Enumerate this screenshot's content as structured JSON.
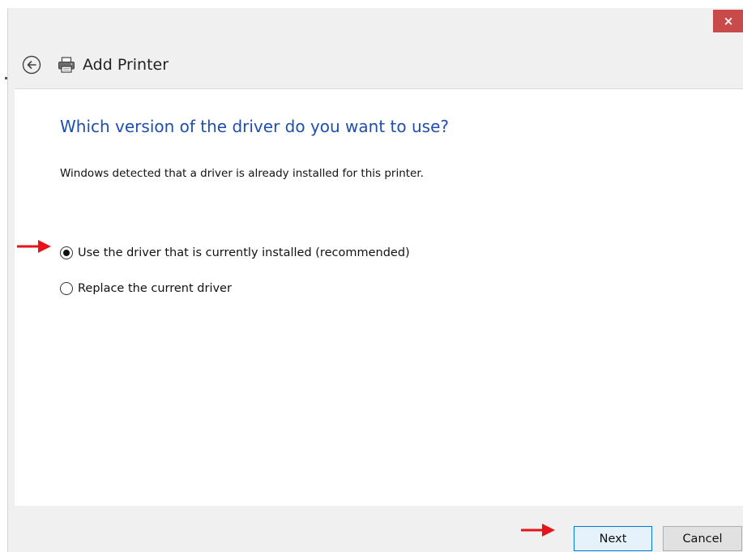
{
  "window": {
    "title": "Add Printer",
    "close_label": "×"
  },
  "wizard": {
    "question": "Which version of the driver do you want to use?",
    "description": "Windows detected that a driver is already installed for this printer.",
    "options": [
      {
        "label": "Use the driver that is currently installed (recommended)",
        "selected": true
      },
      {
        "label": "Replace the current driver",
        "selected": false
      }
    ]
  },
  "footer": {
    "next_label": "Next",
    "cancel_label": "Cancel"
  },
  "colors": {
    "heading_blue": "#1e4fb0",
    "close_red": "#c94a4a",
    "annotation_arrow": "#e5141b",
    "default_button_border": "#0078d7"
  },
  "icons": {
    "back": "back-arrow-circle-icon",
    "printer": "printer-icon",
    "annotation": "red-arrow-icon"
  }
}
